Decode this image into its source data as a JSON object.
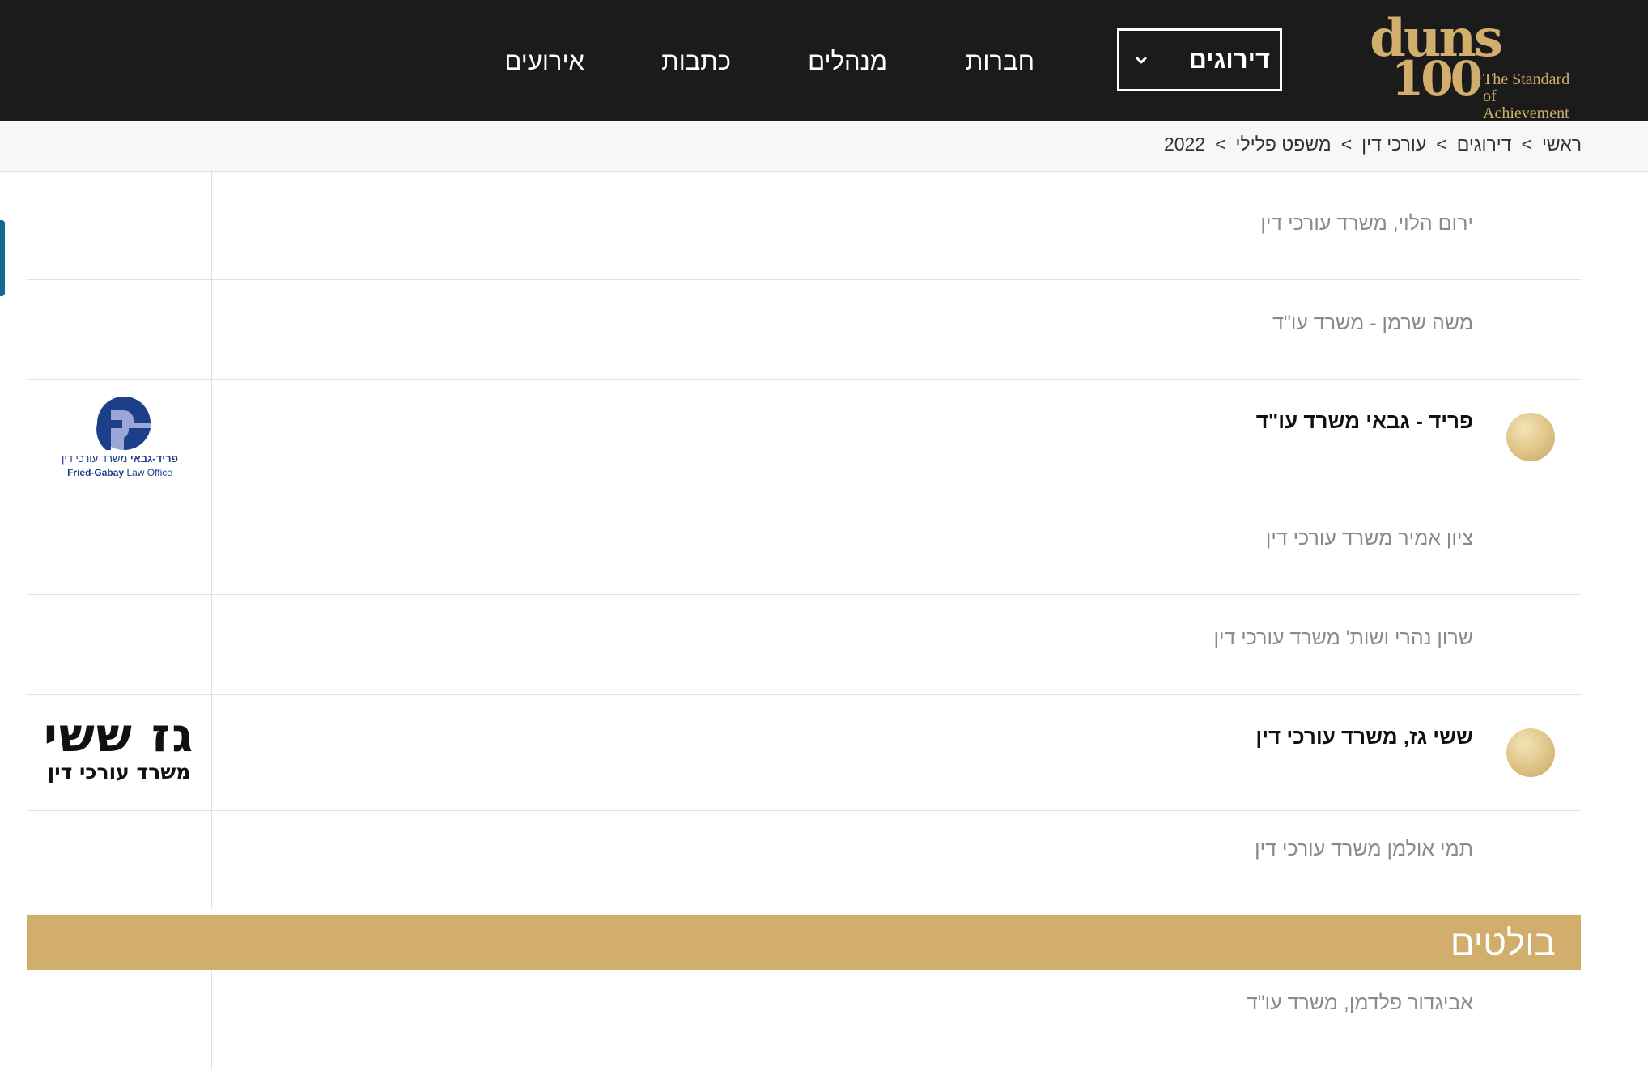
{
  "header": {
    "logo": {
      "word_top": "duns",
      "word_bottom": "100",
      "tagline_1": "The Standard",
      "tagline_2": "of Achievement"
    },
    "nav": {
      "active": "דירוגים",
      "items": [
        "חברות",
        "מנהלים",
        "כתבות",
        "אירועים"
      ]
    }
  },
  "breadcrumb": {
    "items": [
      "ראשי",
      "דירוגים",
      "עורכי דין",
      "משפט פלילי",
      "2022"
    ],
    "separator": ">"
  },
  "rows": [
    {
      "name": "ירום הלוי, משרד עורכי דין",
      "featured": false
    },
    {
      "name": "משה שרמן - משרד עו\"ד",
      "featured": false
    },
    {
      "name": "פריד - גבאי משרד עו\"ד",
      "featured": true
    },
    {
      "name": "ציון אמיר משרד עורכי דין",
      "featured": false
    },
    {
      "name": "שרון נהרי ושות' משרד עורכי דין",
      "featured": false
    },
    {
      "name": "ששי גז, משרד עורכי דין",
      "featured": true
    },
    {
      "name": "תמי אולמן משרד עורכי דין",
      "featured": false
    }
  ],
  "logos": {
    "fried_gabay": {
      "initials": "FG",
      "hebrew_bold": "פריד-גבאי",
      "hebrew_light": "משרד עורכי דין",
      "english_bold": "Fried-Gabay",
      "english_light": "Law Office"
    },
    "gaz_sheshi": {
      "big": "גז ששי",
      "small": "משרד עורכי דין"
    }
  },
  "section": {
    "title": "בולטים",
    "rows": [
      {
        "name": "אביגדור פלדמן, משרד עו\"ד",
        "featured": false
      }
    ]
  },
  "colors": {
    "header_bg": "#1b1b1b",
    "gold": "#d1ae6b",
    "nav_text": "#ffffff",
    "muted_text": "#8a8a8a",
    "logo_blue": "#1d3f8a"
  }
}
